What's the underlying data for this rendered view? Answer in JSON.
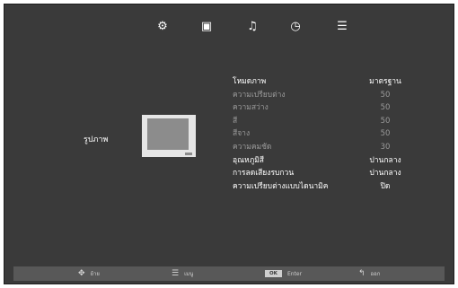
{
  "tabs": [
    {
      "name": "gear-icon",
      "glyph": "⚙"
    },
    {
      "name": "monitor-icon",
      "glyph": "▣"
    },
    {
      "name": "music-note-icon",
      "glyph": "♫"
    },
    {
      "name": "clock-icon",
      "glyph": "◷"
    },
    {
      "name": "lock-icon",
      "glyph": "☰"
    }
  ],
  "selected_tab": "monitor-icon",
  "page_label": "รูปภาพ",
  "menu": [
    {
      "label": "โหมดภาพ",
      "value": "มาตรฐาน",
      "state": "active"
    },
    {
      "label": "ความเปรียบต่าง",
      "value": "50",
      "state": "disabled"
    },
    {
      "label": "ความสว่าง",
      "value": "50",
      "state": "disabled"
    },
    {
      "label": "สี",
      "value": "50",
      "state": "disabled"
    },
    {
      "label": "สีจาง",
      "value": "50",
      "state": "disabled"
    },
    {
      "label": "ความคมชัด",
      "value": "30",
      "state": "disabled"
    },
    {
      "label": "อุณหภูมิสี",
      "value": "ปานกลาง",
      "state": "active"
    },
    {
      "label": "การลดเสียงรบกวน",
      "value": "ปานกลาง",
      "state": "active"
    },
    {
      "label": "ความเปรียบต่างแบบไดนามิค",
      "value": "ปิด",
      "state": "active"
    }
  ],
  "footer": {
    "move": {
      "icon": "dpad-icon",
      "glyph": "✥",
      "label": "ย้าย"
    },
    "menu": {
      "icon": "menu-icon",
      "glyph": "☰",
      "label": "เมนู"
    },
    "enter": {
      "icon": "ok-button-icon",
      "key": "OK",
      "label": "Enter"
    },
    "exit": {
      "icon": "return-icon",
      "glyph": "↰",
      "label": "ออก"
    }
  }
}
